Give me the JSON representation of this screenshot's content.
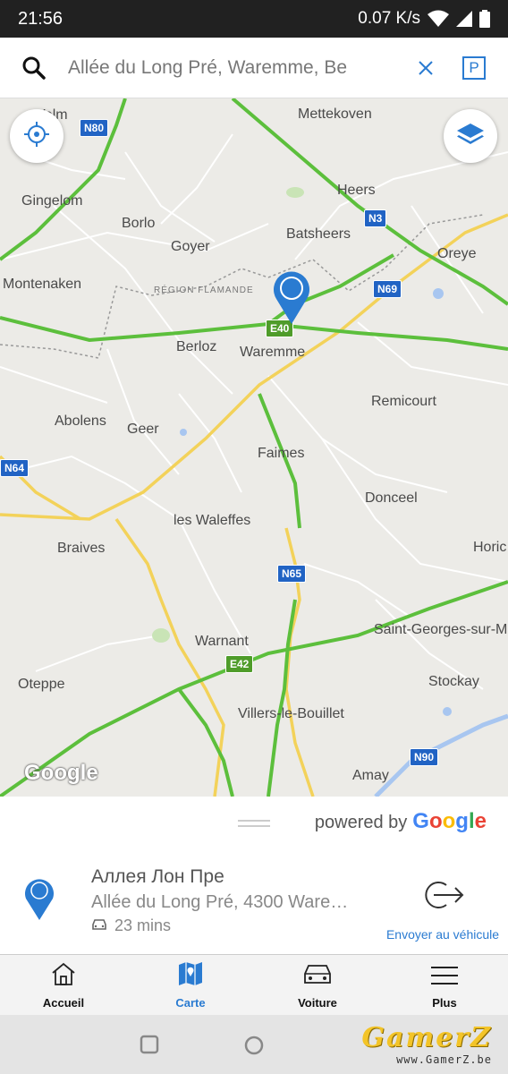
{
  "status_bar": {
    "time": "21:56",
    "network_speed": "0.07 K/s"
  },
  "search": {
    "value": "Allée du Long Pré, Waremme, Be",
    "clear_icon": "close-icon",
    "parking_label": "P"
  },
  "map": {
    "places": {
      "mettekoven": "Mettekoven",
      "gingelom": "Gingelom",
      "borlo": "Borlo",
      "heers": "Heers",
      "goyer": "Goyer",
      "batsheers": "Batsheers",
      "oreye": "Oreye",
      "montenaken": "Montenaken",
      "region": "RÉGION FLAMANDE",
      "berloz": "Berloz",
      "waremme": "Waremme",
      "remicourt": "Remicourt",
      "abolens": "Abolens",
      "geer": "Geer",
      "faimes": "Faimes",
      "donceel": "Donceel",
      "les_waleffes": "les Waleffes",
      "braives": "Braives",
      "horion": "Horic",
      "warnant": "Warnant",
      "saint_georges": "Saint-Georges-sur-Me",
      "oteppe": "Oteppe",
      "stockay": "Stockay",
      "villers": "Villers-le-Bouillet",
      "amay": "Amay",
      "velm": "Velm"
    },
    "roads": {
      "n80": "N80",
      "n3": "N3",
      "n69": "N69",
      "e40": "E40",
      "n64": "N64",
      "n65": "N65",
      "e42": "E42",
      "n90": "N90"
    },
    "attribution": "Google"
  },
  "sheet": {
    "powered_by": "powered by",
    "google": "Google",
    "result": {
      "title": "Аллея Лон Пре",
      "address": "Allée du Long Pré, 4300 Ware…",
      "duration": "23 mins",
      "send_label": "Envoyer au véhicule"
    }
  },
  "nav": {
    "items": [
      {
        "label": "Accueil",
        "icon": "home-icon"
      },
      {
        "label": "Carte",
        "icon": "map-icon"
      },
      {
        "label": "Voiture",
        "icon": "car-icon"
      },
      {
        "label": "Plus",
        "icon": "menu-icon"
      }
    ]
  },
  "watermark": {
    "main": "GamerZ",
    "sub": "www.GamerZ.be"
  },
  "colors": {
    "accent": "#2a7bd1",
    "traffic_green": "#5cbf3c",
    "road_yellow": "#f3d25a",
    "map_bg": "#ecebe7"
  }
}
